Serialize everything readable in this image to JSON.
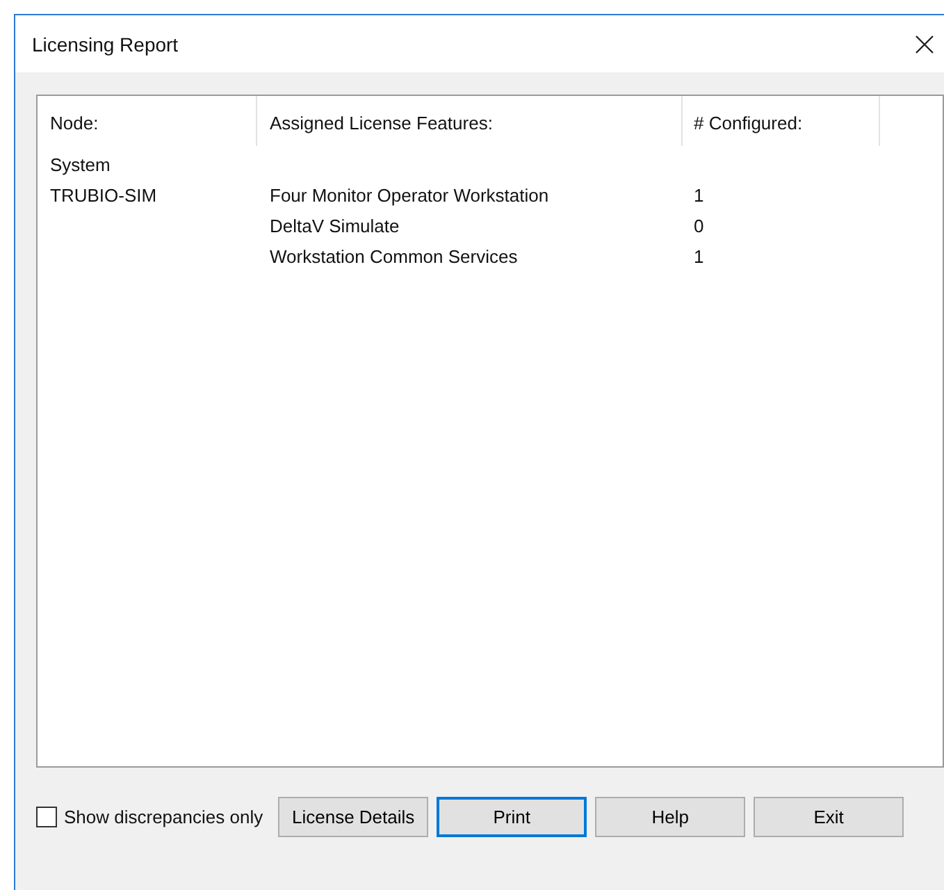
{
  "window": {
    "title": "Licensing Report"
  },
  "table": {
    "columns": [
      "Node:",
      "Assigned License Features:",
      "# Configured:"
    ],
    "rows": [
      {
        "node": "System"
      },
      {
        "node": "TRUBIO-SIM",
        "feature": "Four Monitor Operator Workstation",
        "configured": "1"
      },
      {
        "feature": "DeltaV Simulate",
        "configured": "0"
      },
      {
        "feature": "Workstation Common Services",
        "configured": "1"
      }
    ]
  },
  "checkbox": {
    "label": "Show discrepancies only",
    "checked": false
  },
  "buttons": [
    {
      "label": "License Details",
      "focused": false
    },
    {
      "label": "Print",
      "focused": true
    },
    {
      "label": "Help",
      "focused": false
    },
    {
      "label": "Exit",
      "focused": false
    }
  ]
}
